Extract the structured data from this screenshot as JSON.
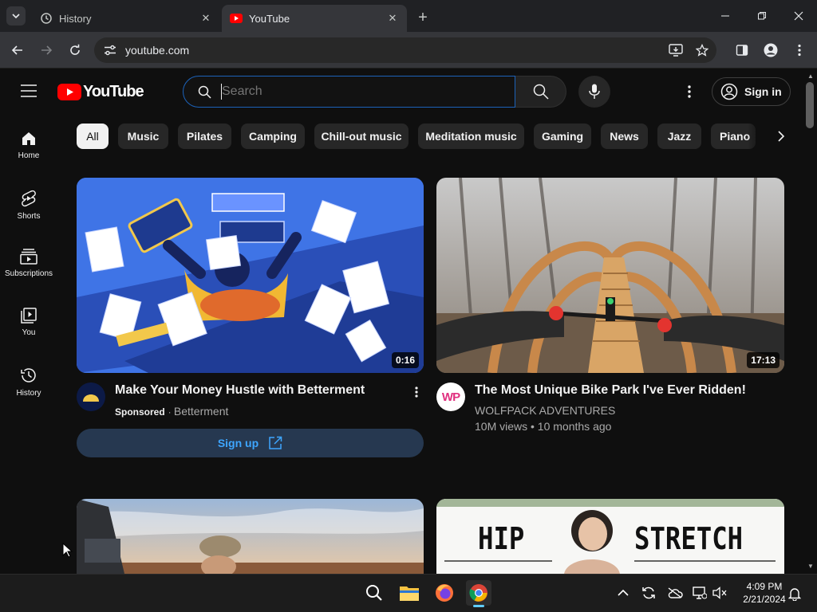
{
  "browser": {
    "tabs": [
      {
        "title": "History",
        "active": false
      },
      {
        "title": "YouTube",
        "active": true
      }
    ],
    "url": "youtube.com"
  },
  "youtube": {
    "logo_text": "YouTube",
    "search_placeholder": "Search",
    "sign_in_label": "Sign in",
    "sidebar": [
      {
        "label": "Home",
        "icon": "home-icon"
      },
      {
        "label": "Shorts",
        "icon": "shorts-icon"
      },
      {
        "label": "Subscriptions",
        "icon": "subscriptions-icon"
      },
      {
        "label": "You",
        "icon": "you-icon"
      },
      {
        "label": "History",
        "icon": "history-icon"
      }
    ],
    "chips": [
      "All",
      "Music",
      "Pilates",
      "Camping",
      "Chill-out music",
      "Meditation music",
      "Gaming",
      "News",
      "Jazz",
      "Piano"
    ],
    "selected_chip": "All",
    "videos": [
      {
        "title": "Make Your Money Hustle with Betterment",
        "sponsored_label": "Sponsored",
        "channel": "Betterment",
        "duration": "0:16",
        "cta": "Sign up"
      },
      {
        "title": "The Most Unique Bike Park I've Ever Ridden!",
        "channel": "WOLFPACK ADVENTURES",
        "meta": "10M views • 10 months ago",
        "duration": "17:13",
        "avatar_text": "WP"
      }
    ],
    "row2": [
      {
        "thumb_text_left": "HIP",
        "thumb_text_right": "STRETCH"
      }
    ]
  },
  "taskbar": {
    "time": "4:09 PM",
    "date": "2/21/2024"
  },
  "colors": {
    "accent": "#3ea6ff",
    "brand_red": "#ff0000",
    "background": "#0f0f0f"
  }
}
